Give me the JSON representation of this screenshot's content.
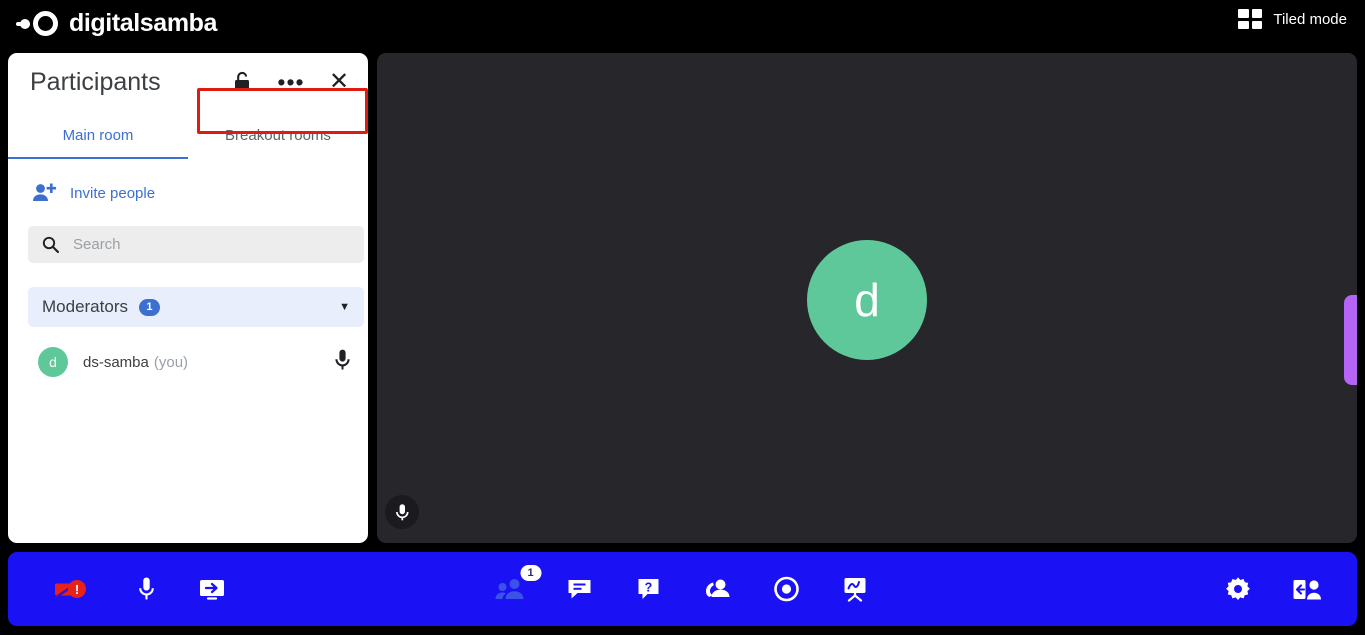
{
  "topbar": {
    "brand": "digitalsamba",
    "brand_logo_icon": "digitalsamba-logo-icon",
    "tiled_mode_label": "Tiled mode",
    "tiled_mode_icon": "grid-2x2-icon"
  },
  "panel": {
    "title": "Participants",
    "lock_icon": "unlock-icon",
    "more_icon": "more-options-icon",
    "more_glyph": "•••",
    "close_icon": "close-icon",
    "close_glyph": "✕",
    "tabs": [
      {
        "label": "Main room",
        "active": true
      },
      {
        "label": "Breakout rooms",
        "active": false,
        "highlighted": true
      }
    ],
    "highlight_color": "#e01b10",
    "accent_color": "#3c6fd0",
    "invite": {
      "label": "Invite people",
      "icon": "person-add-icon"
    },
    "search": {
      "placeholder": "Search",
      "value": "",
      "icon": "search-icon"
    },
    "groups": [
      {
        "name": "Moderators",
        "count": "1",
        "chevron_icon": "chevron-down-icon",
        "chevron_glyph": "▼",
        "participants": [
          {
            "initial": "d",
            "name": "ds-samba",
            "you_label": "(you)",
            "avatar_color": "#5fc89b",
            "mic_icon": "microphone-icon"
          }
        ]
      }
    ]
  },
  "stage": {
    "avatar_initial": "d",
    "avatar_color": "#5fc89b",
    "background_color": "#26262b",
    "mic_badge_icon": "microphone-icon",
    "edge_pill_color": "#b565f5"
  },
  "toolbar": {
    "background_color": "#1b11f5",
    "left": [
      {
        "name": "camera-off-button",
        "icon": "camera-off-icon",
        "alert": "!"
      },
      {
        "name": "microphone-button",
        "icon": "microphone-icon"
      },
      {
        "name": "screen-share-button",
        "icon": "screen-share-icon"
      }
    ],
    "center": [
      {
        "name": "participants-button",
        "icon": "people-icon",
        "badge": "1",
        "active": true
      },
      {
        "name": "chat-button",
        "icon": "chat-bubble-icon"
      },
      {
        "name": "qa-button",
        "icon": "question-mark-icon"
      },
      {
        "name": "raise-hand-button",
        "icon": "raise-hand-icon"
      },
      {
        "name": "record-button",
        "icon": "record-circle-icon"
      },
      {
        "name": "whiteboard-button",
        "icon": "whiteboard-icon"
      }
    ],
    "right": [
      {
        "name": "settings-button",
        "icon": "gear-icon"
      },
      {
        "name": "leave-meeting-button",
        "icon": "leave-meeting-icon"
      }
    ]
  }
}
